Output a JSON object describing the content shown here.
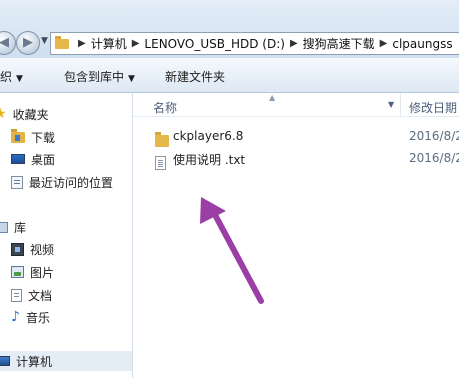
{
  "address_bar": {
    "breadcrumbs": [
      "计算机",
      "LENOVO_USB_HDD (D:)",
      "搜狗高速下载",
      "clpaungss"
    ]
  },
  "toolbar": {
    "organize": "组织",
    "include_in_library": "包含到库中",
    "new_folder": "新建文件夹"
  },
  "nav": {
    "favorites": "收藏夹",
    "downloads": "下载",
    "desktop": "桌面",
    "recent": "最近访问的位置",
    "libraries": "库",
    "videos": "视频",
    "pictures": "图片",
    "documents": "文档",
    "music": "音乐",
    "computer": "计算机"
  },
  "file_list": {
    "columns": {
      "name": "名称",
      "date": "修改日期"
    },
    "rows": [
      {
        "name": "ckplayer6.8",
        "type": "folder",
        "date": "2016/8/2"
      },
      {
        "name": "使用说明 .txt",
        "type": "text",
        "date": "2016/8/2"
      }
    ]
  },
  "annotation": {
    "arrow_color": "#9b3fa6"
  }
}
